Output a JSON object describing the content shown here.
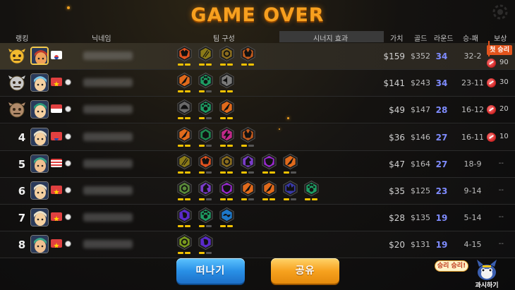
{
  "title": "GAME OVER",
  "headers": {
    "rank": "랭킹",
    "nickname": "닉네임",
    "team": "팀 구성",
    "synergy": "시너지 효과",
    "value": "가치",
    "gold": "골드",
    "round": "라운드",
    "winloss": "승-패",
    "reward": "보상"
  },
  "first_win_label": "첫 승리",
  "rows": [
    {
      "rank": "",
      "badge": "gold-crown",
      "value": "$159",
      "gold": "$352",
      "round": "34",
      "wl": "32-2",
      "reward": "90",
      "traits": [
        "demon",
        "blade",
        "gear",
        "beast"
      ]
    },
    {
      "rank": "",
      "badge": "silver-crown",
      "value": "$141",
      "gold": "$243",
      "round": "34",
      "wl": "23-11",
      "reward": "30",
      "traits": [
        "feather",
        "paw",
        "axe"
      ]
    },
    {
      "rank": "",
      "badge": "bronze-crown",
      "value": "$49",
      "gold": "$147",
      "round": "28",
      "wl": "16-12",
      "reward": "20",
      "traits": [
        "helmet",
        "paw",
        "feather"
      ]
    },
    {
      "rank": "4",
      "badge": "",
      "value": "$36",
      "gold": "$146",
      "round": "27",
      "wl": "16-11",
      "reward": "10",
      "traits": [
        "feather",
        "cube",
        "bolt",
        "beast"
      ]
    },
    {
      "rank": "5",
      "badge": "",
      "value": "$47",
      "gold": "$164",
      "round": "27",
      "wl": "18-9",
      "reward": "--",
      "traits": [
        "blade",
        "demon",
        "gear",
        "knight",
        "mask",
        "feather"
      ]
    },
    {
      "rank": "6",
      "badge": "",
      "value": "$35",
      "gold": "$125",
      "round": "23",
      "wl": "9-14",
      "reward": "--",
      "traits": [
        "rock",
        "knight",
        "mask",
        "feather",
        "feather",
        "crown",
        "paw"
      ]
    },
    {
      "rank": "7",
      "badge": "",
      "value": "$28",
      "gold": "$135",
      "round": "19",
      "wl": "5-14",
      "reward": "--",
      "traits": [
        "spiral",
        "paw",
        "wave"
      ]
    },
    {
      "rank": "8",
      "badge": "",
      "value": "$20",
      "gold": "$131",
      "round": "19",
      "wl": "4-15",
      "reward": "--",
      "traits": [
        "cluster",
        "spiral"
      ]
    }
  ],
  "buttons": {
    "leave": "떠나기",
    "share": "공유",
    "victory": "승리 승리!",
    "show_off": "과시하기"
  },
  "colors": {
    "title": "#f7a01f",
    "round": "#7f8cff",
    "leave": "#2990e6",
    "share": "#f7a21f"
  }
}
